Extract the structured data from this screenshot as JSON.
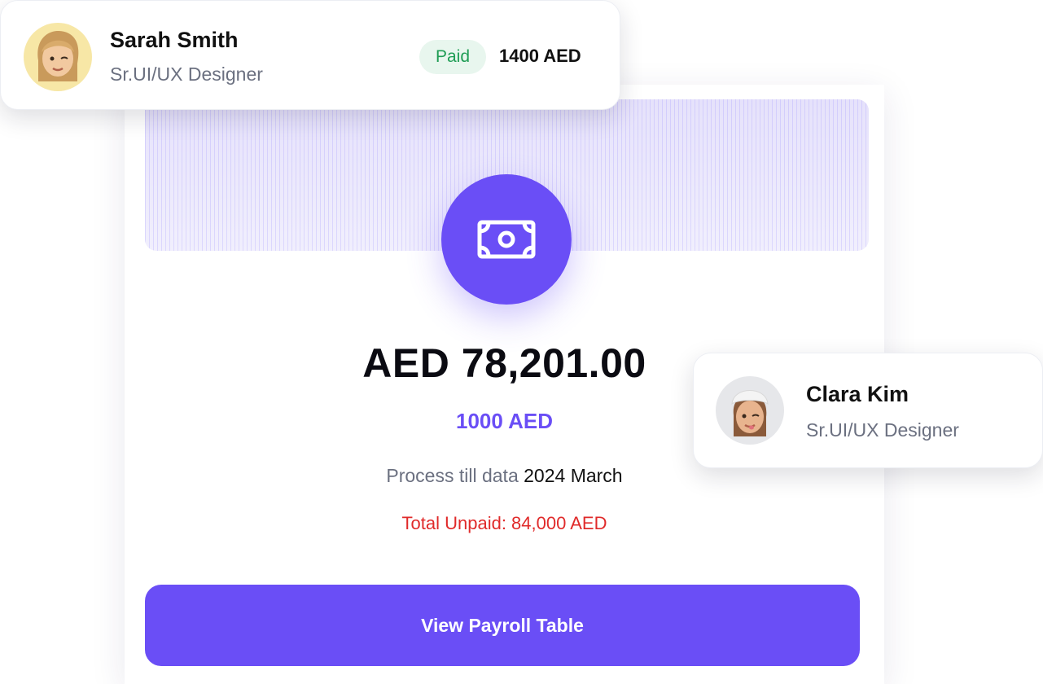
{
  "payroll_card": {
    "amount": "AED 78,201.00",
    "sub_amount": "1000 AED",
    "process_label": "Process till data",
    "process_date": "2024 March",
    "unpaid_text": "Total Unpaid: 84,000 AED",
    "button_label": "View Payroll Table",
    "icon": "money-bill-icon"
  },
  "employees": [
    {
      "name": "Sarah Smith",
      "role": "Sr.UI/UX Designer",
      "status": "Paid",
      "amount": "1400 AED",
      "avatar": "memoji-avatar"
    },
    {
      "name": "Clara Kim",
      "role": "Sr.UI/UX Designer",
      "avatar": "memoji-avatar"
    }
  ],
  "colors": {
    "accent": "#6a4ef6",
    "paid_text": "#1f9d55",
    "paid_bg": "#e8f6ee",
    "unpaid": "#e02a2a"
  }
}
